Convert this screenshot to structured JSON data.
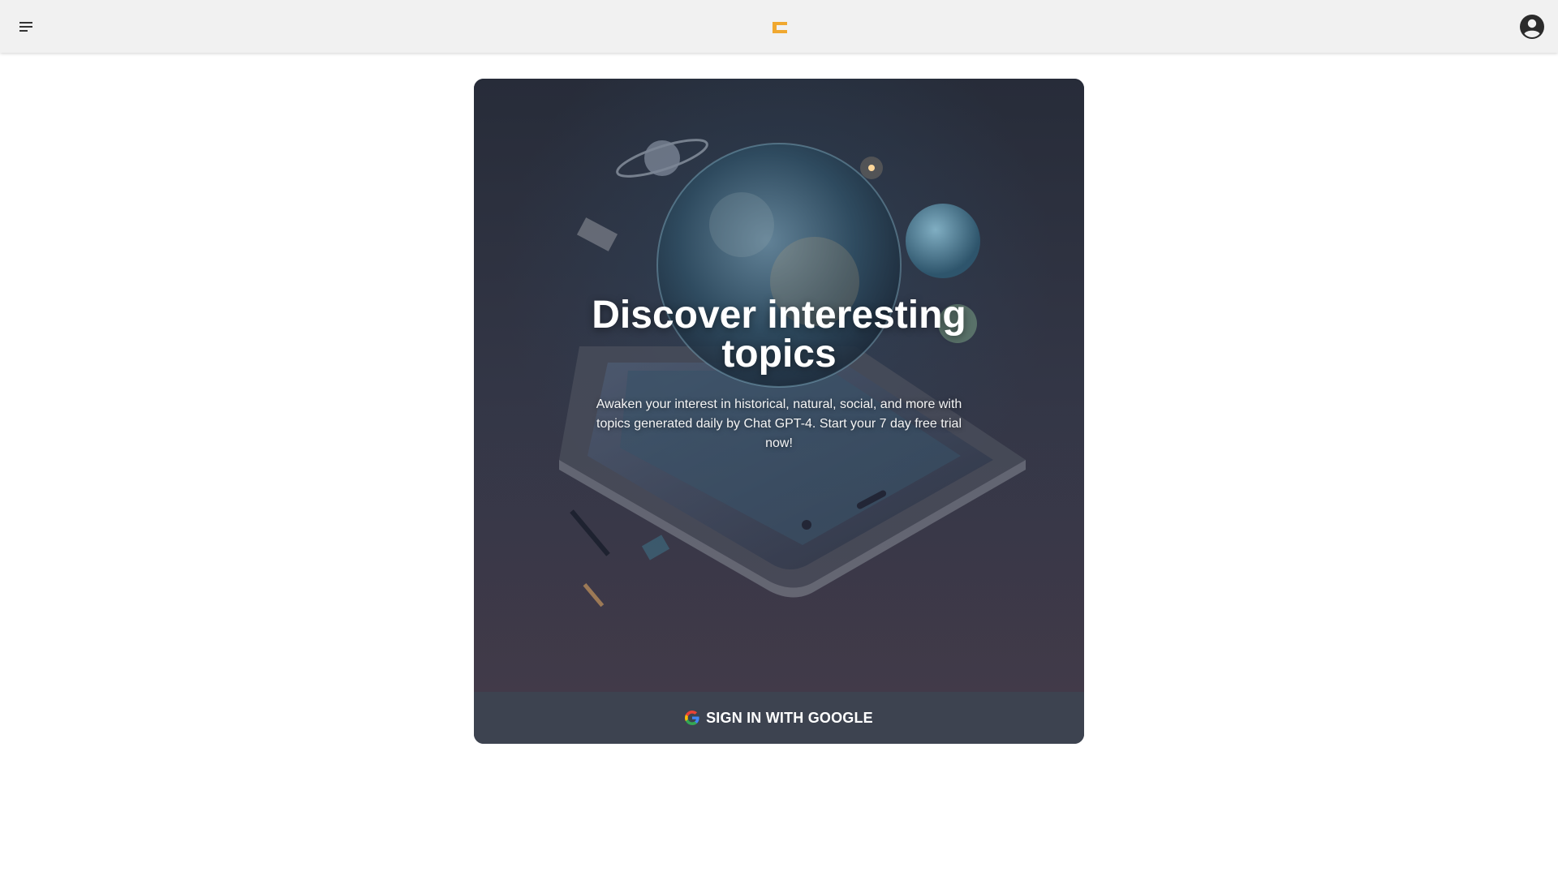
{
  "header": {
    "menu_icon": "menu-icon",
    "logo_icon": "brand-logo-icon",
    "account_icon": "account-circle-icon",
    "logo_color": "#f0a830"
  },
  "hero": {
    "title": "Discover interesting topics",
    "description": "Awaken your interest in historical, natural, social, and more with topics generated daily by Chat GPT-4. Start your 7 day free trial now!",
    "image": "globe-over-smartphone-and-books-illustration"
  },
  "signin": {
    "label": "SIGN IN WITH GOOGLE",
    "icon": "google-icon"
  }
}
